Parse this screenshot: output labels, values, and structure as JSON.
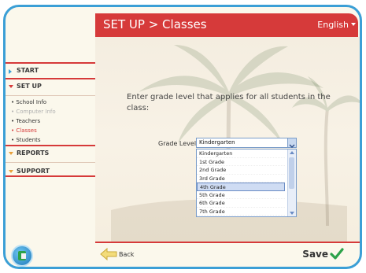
{
  "header": {
    "title": "SET UP > Classes",
    "language": "English"
  },
  "sidebar": {
    "start": "START",
    "setup": "SET UP",
    "setup_items": [
      "School Info",
      "Computer Info",
      "Teachers",
      "Classes",
      "Students"
    ],
    "reports": "REPORTS",
    "support": "SUPPORT"
  },
  "main": {
    "prompt": "Enter grade level that applies for all students in the class:",
    "grade_label": "Grade Level:",
    "selected_grade": "Kindergarten",
    "grade_options": [
      "Kindergarten",
      "1st Grade",
      "2nd Grade",
      "3rd Grade",
      "4th Grade",
      "5th Grade",
      "6th Grade",
      "7th Grade"
    ],
    "highlighted_option": "4th Grade"
  },
  "footer": {
    "back_label": "Back",
    "save_label": "Save"
  },
  "colors": {
    "accent_red": "#d63a3a",
    "frame_blue": "#3b9fd6",
    "save_green": "#2ba24a"
  }
}
